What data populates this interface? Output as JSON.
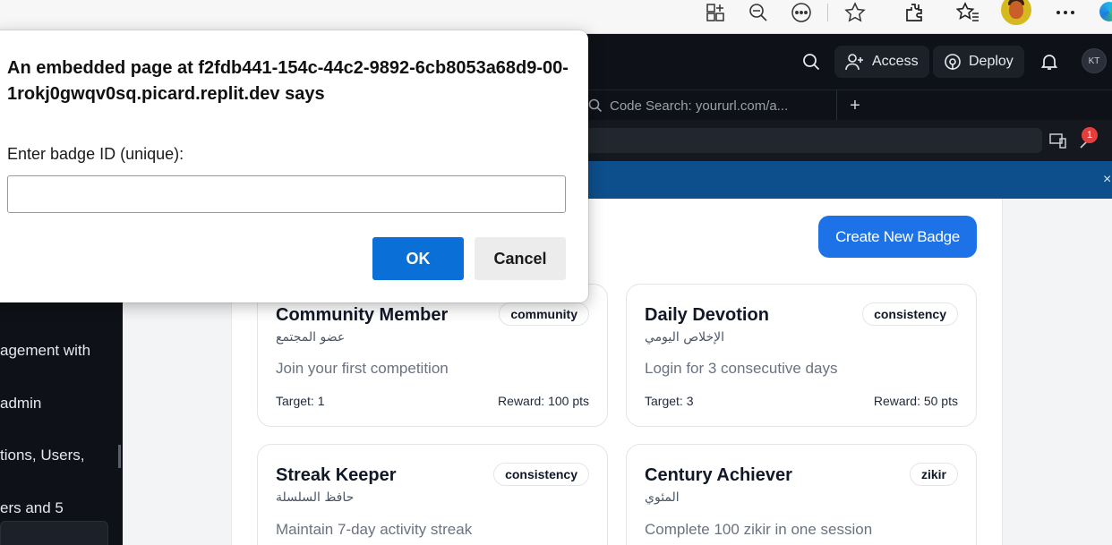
{
  "browser": {
    "icons": [
      "app-grid-icon",
      "zoom-out-icon",
      "more-circle-icon",
      "favorite-star-icon",
      "extensions-icon",
      "favorites-icon",
      "profile-avatar",
      "more-icon",
      "edge-logo"
    ]
  },
  "replit": {
    "access_label": "Access",
    "deploy_label": "Deploy",
    "user_initials": "KT",
    "tab_label": "Code Search: yoururl.com/a...",
    "tab_add": "+",
    "notification_count": "1",
    "banner_close": "×"
  },
  "sidebar": {
    "lines": [
      "agement with",
      "admin",
      "tions, Users,",
      "ers and 5"
    ]
  },
  "main": {
    "create_button": "Create New Badge",
    "cards": [
      {
        "title": "Community Member",
        "arabic": "عضو المجتمع",
        "tag": "community",
        "description": "Join your first competition",
        "target": "Target: 1",
        "reward": "Reward: 100 pts"
      },
      {
        "title": "Daily Devotion",
        "arabic": "الإخلاص اليومي",
        "tag": "consistency",
        "description": "Login for 3 consecutive days",
        "target": "Target: 3",
        "reward": "Reward: 50 pts"
      },
      {
        "title": "Streak Keeper",
        "arabic": "حافظ السلسلة",
        "tag": "consistency",
        "description": "Maintain 7-day activity streak",
        "target": "",
        "reward": ""
      },
      {
        "title": "Century Achiever",
        "arabic": "المئوي",
        "tag": "zikir",
        "description": "Complete 100 zikir in one session",
        "target": "",
        "reward": ""
      }
    ]
  },
  "dialog": {
    "title": "An embedded page at f2fdb441-154c-44c2-9892-6cb8053a68d9-00-1rokj0gwqv0sq.picard.replit.dev says",
    "prompt": "Enter badge ID (unique):",
    "input_value": "",
    "ok_label": "OK",
    "cancel_label": "Cancel"
  },
  "colors": {
    "accent": "#1d72e8",
    "dialog_ok": "#0a6fd6",
    "banner": "#0d4f8c",
    "dark_bg": "#0e1117"
  }
}
